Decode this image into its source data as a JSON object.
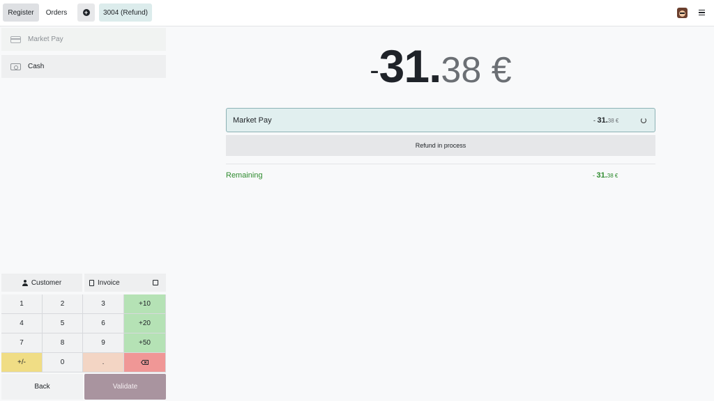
{
  "topbar": {
    "register_label": "Register",
    "orders_label": "Orders",
    "add_icon": "plus-circle-icon",
    "order_tab_label": "3004 (Refund)",
    "avatar_icon": "user-avatar",
    "menu_icon": "hamburger-menu-icon"
  },
  "payment_methods": [
    {
      "label": "Market Pay",
      "icon": "credit-card-icon"
    },
    {
      "label": "Cash",
      "icon": "cash-icon"
    }
  ],
  "actions": {
    "customer_label": "Customer",
    "invoice_label": "Invoice",
    "back_label": "Back",
    "validate_label": "Validate"
  },
  "numpad": {
    "keys": [
      "1",
      "2",
      "3",
      "+10",
      "4",
      "5",
      "6",
      "+20",
      "7",
      "8",
      "9",
      "+50",
      "+/-",
      "0",
      ".",
      "backspace"
    ]
  },
  "total": {
    "sign": "-",
    "integer": "31.",
    "decimal": "38 €"
  },
  "payment_line": {
    "name": "Market Pay",
    "amount_sign": "- ",
    "amount_integer": "31.",
    "amount_decimal": "38 €",
    "status_icon": "loading-spinner-icon"
  },
  "refund_status": "Refund in process",
  "remaining": {
    "label": "Remaining",
    "amount_sign": "- ",
    "amount_integer": "31.",
    "amount_decimal": "38 €"
  },
  "colors": {
    "accent_teal": "#e1efef",
    "remaining_green": "#2e8b2e",
    "validate": "#a9949f",
    "numpad_green": "#b5e2b5",
    "numpad_yellow": "#f0dd85",
    "numpad_peach": "#f3d5c4",
    "numpad_red": "#f09796"
  }
}
